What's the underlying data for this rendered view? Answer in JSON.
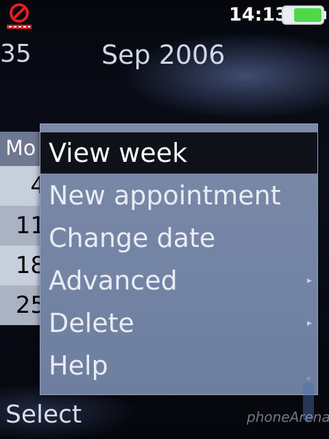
{
  "status_bar": {
    "time": "14:13",
    "signal_icon": "no-signal-icon",
    "battery_icon": "battery-icon",
    "battery_color": "#4fd84a"
  },
  "calendar": {
    "week_number": "35",
    "month_title": "Sep 2006",
    "weekday_header": "Mo",
    "week_starts": [
      "4",
      "11",
      "18",
      "25"
    ]
  },
  "menu": {
    "items": [
      {
        "label": "View week",
        "selected": true,
        "has_submenu": false
      },
      {
        "label": "New appointment",
        "selected": false,
        "has_submenu": false
      },
      {
        "label": "Change date",
        "selected": false,
        "has_submenu": false
      },
      {
        "label": "Advanced",
        "selected": false,
        "has_submenu": true
      },
      {
        "label": "Delete",
        "selected": false,
        "has_submenu": true
      },
      {
        "label": "Help",
        "selected": false,
        "has_submenu": false
      }
    ],
    "submenu_arrow": "▸"
  },
  "softkeys": {
    "left": "Select"
  },
  "watermark": {
    "text": "phoneArena"
  }
}
